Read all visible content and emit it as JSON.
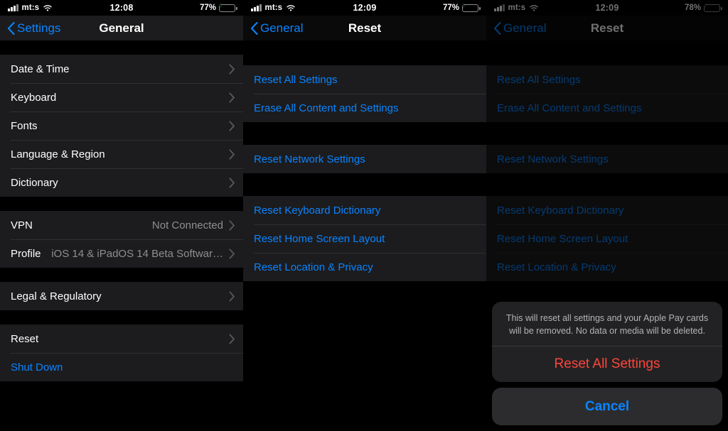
{
  "panels": [
    {
      "status": {
        "carrier": "mt:s",
        "time": "12:08",
        "battery_pct": "77%",
        "signal_icon": "cellular-signal-icon",
        "wifi_icon": "wifi-icon",
        "battery_icon": "battery-charging-icon"
      },
      "nav": {
        "back_label": "Settings",
        "title": "General",
        "back_icon": "chevron-left-icon"
      },
      "groups": [
        {
          "rows": [
            {
              "label": "Date & Time",
              "value": "",
              "chevron": true,
              "tint": false
            },
            {
              "label": "Keyboard",
              "value": "",
              "chevron": true,
              "tint": false
            },
            {
              "label": "Fonts",
              "value": "",
              "chevron": true,
              "tint": false
            },
            {
              "label": "Language & Region",
              "value": "",
              "chevron": true,
              "tint": false
            },
            {
              "label": "Dictionary",
              "value": "",
              "chevron": true,
              "tint": false
            }
          ]
        },
        {
          "rows": [
            {
              "label": "VPN",
              "value": "Not Connected",
              "chevron": true,
              "tint": false
            },
            {
              "label": "Profile",
              "value": "iOS 14 & iPadOS 14 Beta Softwar…",
              "chevron": true,
              "tint": false
            }
          ]
        },
        {
          "rows": [
            {
              "label": "Legal & Regulatory",
              "value": "",
              "chevron": true,
              "tint": false
            }
          ]
        },
        {
          "rows": [
            {
              "label": "Reset",
              "value": "",
              "chevron": true,
              "tint": false
            },
            {
              "label": "Shut Down",
              "value": "",
              "chevron": false,
              "tint": true
            }
          ]
        }
      ]
    },
    {
      "status": {
        "carrier": "mt:s",
        "time": "12:09",
        "battery_pct": "77%",
        "signal_icon": "cellular-signal-icon",
        "wifi_icon": "wifi-icon",
        "battery_icon": "battery-charging-icon"
      },
      "nav": {
        "back_label": "General",
        "title": "Reset",
        "back_icon": "chevron-left-icon"
      },
      "groups": [
        {
          "rows": [
            {
              "label": "Reset All Settings",
              "value": "",
              "chevron": false,
              "tint": true
            },
            {
              "label": "Erase All Content and Settings",
              "value": "",
              "chevron": false,
              "tint": true
            }
          ]
        },
        {
          "rows": [
            {
              "label": "Reset Network Settings",
              "value": "",
              "chevron": false,
              "tint": true
            }
          ]
        },
        {
          "rows": [
            {
              "label": "Reset Keyboard Dictionary",
              "value": "",
              "chevron": false,
              "tint": true
            },
            {
              "label": "Reset Home Screen Layout",
              "value": "",
              "chevron": false,
              "tint": true
            },
            {
              "label": "Reset Location & Privacy",
              "value": "",
              "chevron": false,
              "tint": true
            }
          ]
        }
      ]
    },
    {
      "status": {
        "carrier": "mt:s",
        "time": "12:09",
        "battery_pct": "78%",
        "signal_icon": "cellular-signal-icon",
        "wifi_icon": "wifi-icon",
        "battery_icon": "battery-charging-icon"
      },
      "nav": {
        "back_label": "General",
        "title": "Reset",
        "back_icon": "chevron-left-icon"
      },
      "groups": [
        {
          "rows": [
            {
              "label": "Reset All Settings",
              "value": "",
              "chevron": false,
              "tint": true
            },
            {
              "label": "Erase All Content and Settings",
              "value": "",
              "chevron": false,
              "tint": true
            }
          ]
        },
        {
          "rows": [
            {
              "label": "Reset Network Settings",
              "value": "",
              "chevron": false,
              "tint": true
            }
          ]
        },
        {
          "rows": [
            {
              "label": "Reset Keyboard Dictionary",
              "value": "",
              "chevron": false,
              "tint": true
            },
            {
              "label": "Reset Home Screen Layout",
              "value": "",
              "chevron": false,
              "tint": true
            },
            {
              "label": "Reset Location & Privacy",
              "value": "",
              "chevron": false,
              "tint": true
            }
          ]
        }
      ],
      "action_sheet": {
        "message": "This will reset all settings and your Apple Pay cards will be removed. No data or media will be deleted.",
        "destructive_label": "Reset All Settings",
        "cancel_label": "Cancel"
      }
    }
  ],
  "colors": {
    "tint_blue": "#0a84ff",
    "destructive_red": "#ff453a",
    "cell_background": "#1c1c1e",
    "secondary_text": "#8e8e93",
    "battery_green": "#33d158"
  }
}
